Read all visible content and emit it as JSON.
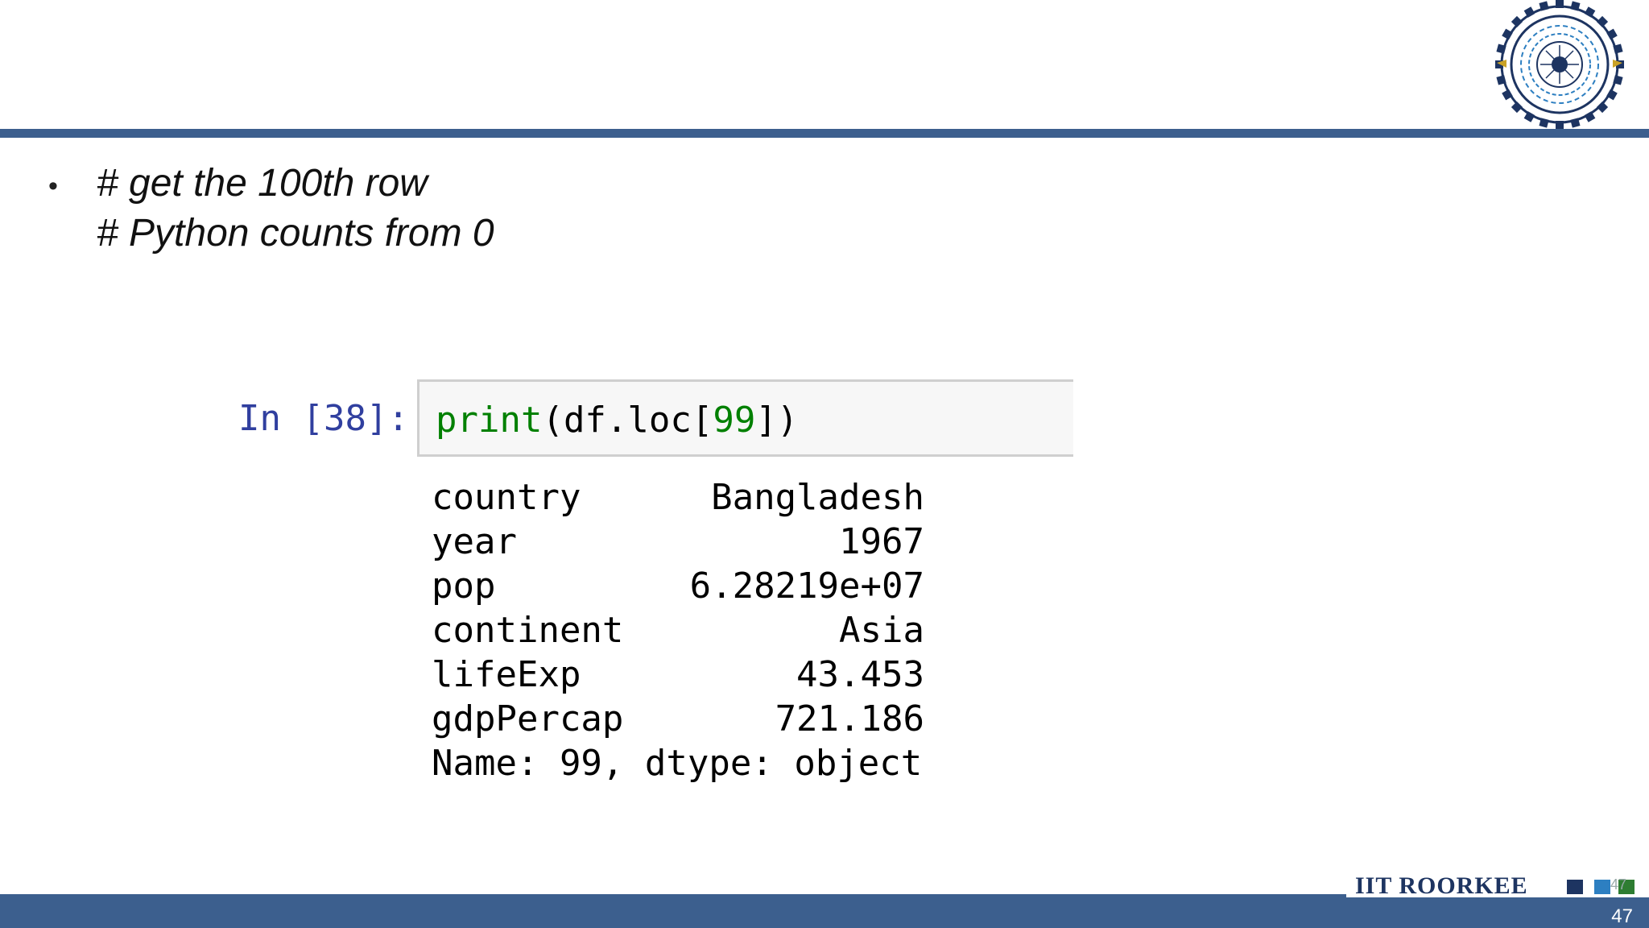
{
  "slide": {
    "bullet_lines": [
      "# get the 100th row",
      "# Python counts from 0"
    ]
  },
  "notebook": {
    "prompt": "In [38]:",
    "code": {
      "builtin": "print",
      "open": "(df.loc[",
      "number": "99",
      "close": "])"
    },
    "output_rows": [
      {
        "key": "country",
        "value": "Bangladesh"
      },
      {
        "key": "year",
        "value": "1967"
      },
      {
        "key": "pop",
        "value": "6.28219e+07"
      },
      {
        "key": "continent",
        "value": "Asia"
      },
      {
        "key": "lifeExp",
        "value": "43.453"
      },
      {
        "key": "gdpPercap",
        "value": "721.186"
      }
    ],
    "output_footer": "Name: 99, dtype: object"
  },
  "footer": {
    "brand": "IIT ROORKEE",
    "small_number": "47",
    "page_number": "47"
  },
  "logo": {
    "icon": "iit-roorkee-emblem-icon"
  },
  "colors": {
    "rule": "#3c5f8e",
    "prompt": "#303f9f",
    "code_green": "#008000"
  }
}
